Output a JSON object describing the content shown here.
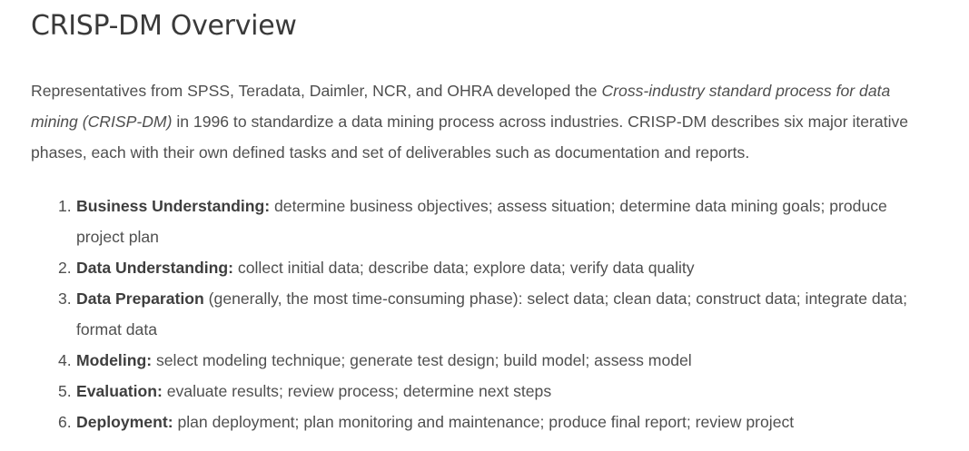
{
  "article": {
    "title": "CRISP-DM Overview",
    "intro": {
      "part1": "Representatives from SPSS, Teradata, Daimler, NCR, and OHRA developed the ",
      "emphasis": "Cross-industry standard process for data mining (CRISP-DM)",
      "part2": " in 1996 to standardize a data mining process across industries. CRISP-DM describes six major iterative phases, each with their own defined tasks and set of deliverables such as documentation and reports."
    },
    "phases": [
      {
        "number": "1.",
        "name": "Business Understanding:",
        "desc": " determine business objectives; assess situation; determine data mining goals; produce project plan"
      },
      {
        "number": "2.",
        "name": "Data Understanding:",
        "desc": " collect initial data; describe data; explore data; verify data quality"
      },
      {
        "number": "3.",
        "name": "Data Preparation",
        "desc": " (generally, the most time-consuming phase): select data; clean data; construct data; integrate data; format data"
      },
      {
        "number": "4.",
        "name": "Modeling:",
        "desc": " select modeling technique; generate test design; build model; assess model"
      },
      {
        "number": "5.",
        "name": "Evaluation:",
        "desc": " evaluate results; review process; determine next steps"
      },
      {
        "number": "6.",
        "name": "Deployment:",
        "desc": " plan deployment; plan monitoring and maintenance; produce final report; review project"
      }
    ]
  }
}
